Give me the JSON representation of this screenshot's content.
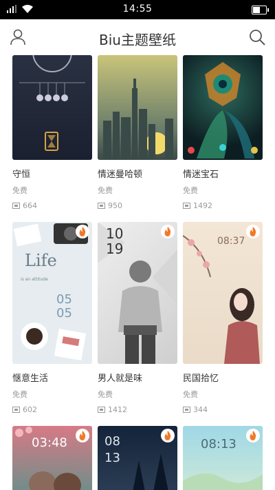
{
  "status": {
    "time": "14:55"
  },
  "header": {
    "title": "Biu主题壁纸"
  },
  "cards": [
    {
      "name": "守恒",
      "price": "免费",
      "downloads": "664"
    },
    {
      "name": "情迷曼哈顿",
      "price": "免费",
      "downloads": "950"
    },
    {
      "name": "情迷宝石",
      "price": "免费",
      "downloads": "1492"
    },
    {
      "name": "惬意生活",
      "price": "免费",
      "downloads": "602"
    },
    {
      "name": "男人就是味",
      "price": "免费",
      "downloads": "1412"
    },
    {
      "name": "民国拾忆",
      "price": "免费",
      "downloads": "344"
    }
  ],
  "thumb_text": {
    "life": "Life",
    "life_sub": "is an attitude",
    "life_time_h": "05",
    "life_time_m": "05",
    "man_time_h": "10",
    "man_time_m": "19",
    "minguo_time": "08:37",
    "row3_a_time": "03:48",
    "row3_b_time_h": "08",
    "row3_b_time_m": "13",
    "row3_c_time": "08:13"
  },
  "icons": [
    "user-icon",
    "search-icon",
    "signal-icon",
    "wifi-icon",
    "battery-icon",
    "download-icon",
    "fire-icon"
  ]
}
